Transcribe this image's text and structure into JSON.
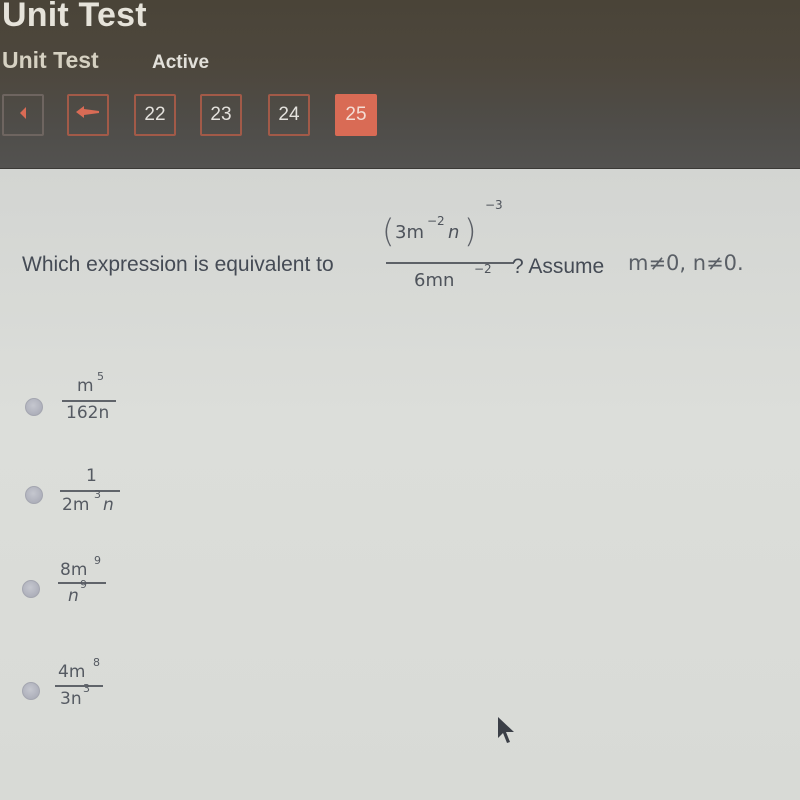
{
  "header": {
    "app_title": "Unit Test",
    "sub_title": "Unit Test",
    "status": "Active"
  },
  "nav": {
    "buttons": [
      {
        "label": "",
        "icon": "first-page-icon"
      },
      {
        "label": "",
        "icon": "back-arrow-icon"
      },
      {
        "label": "22"
      },
      {
        "label": "23"
      },
      {
        "label": "24"
      },
      {
        "label": "25",
        "active": true
      }
    ]
  },
  "question": {
    "prompt": "Which expression is equivalent to",
    "expression": {
      "numerator_base": "3m",
      "numerator_base_exp": "−2",
      "numerator_var": "n",
      "numerator_outer_exp": "−3",
      "denominator": "6mn",
      "denominator_exp": "−2"
    },
    "suffix": "? Assume",
    "condition": "m≠0, n≠0."
  },
  "options": [
    {
      "num": "m",
      "num_exp": "5",
      "den": "162n",
      "den_exp": ""
    },
    {
      "num": "1",
      "num_exp": "",
      "den": "2m",
      "den_exp": "3",
      "den_tail": "n"
    },
    {
      "num": "8m",
      "num_exp": "9",
      "den": "n",
      "den_exp": "9"
    },
    {
      "num": "4m",
      "num_exp": "8",
      "den": "3n",
      "den_exp": "3"
    }
  ],
  "colors": {
    "accent": "#d96b55",
    "header_bg": "#4d473d",
    "content_bg": "#d9dad6"
  }
}
